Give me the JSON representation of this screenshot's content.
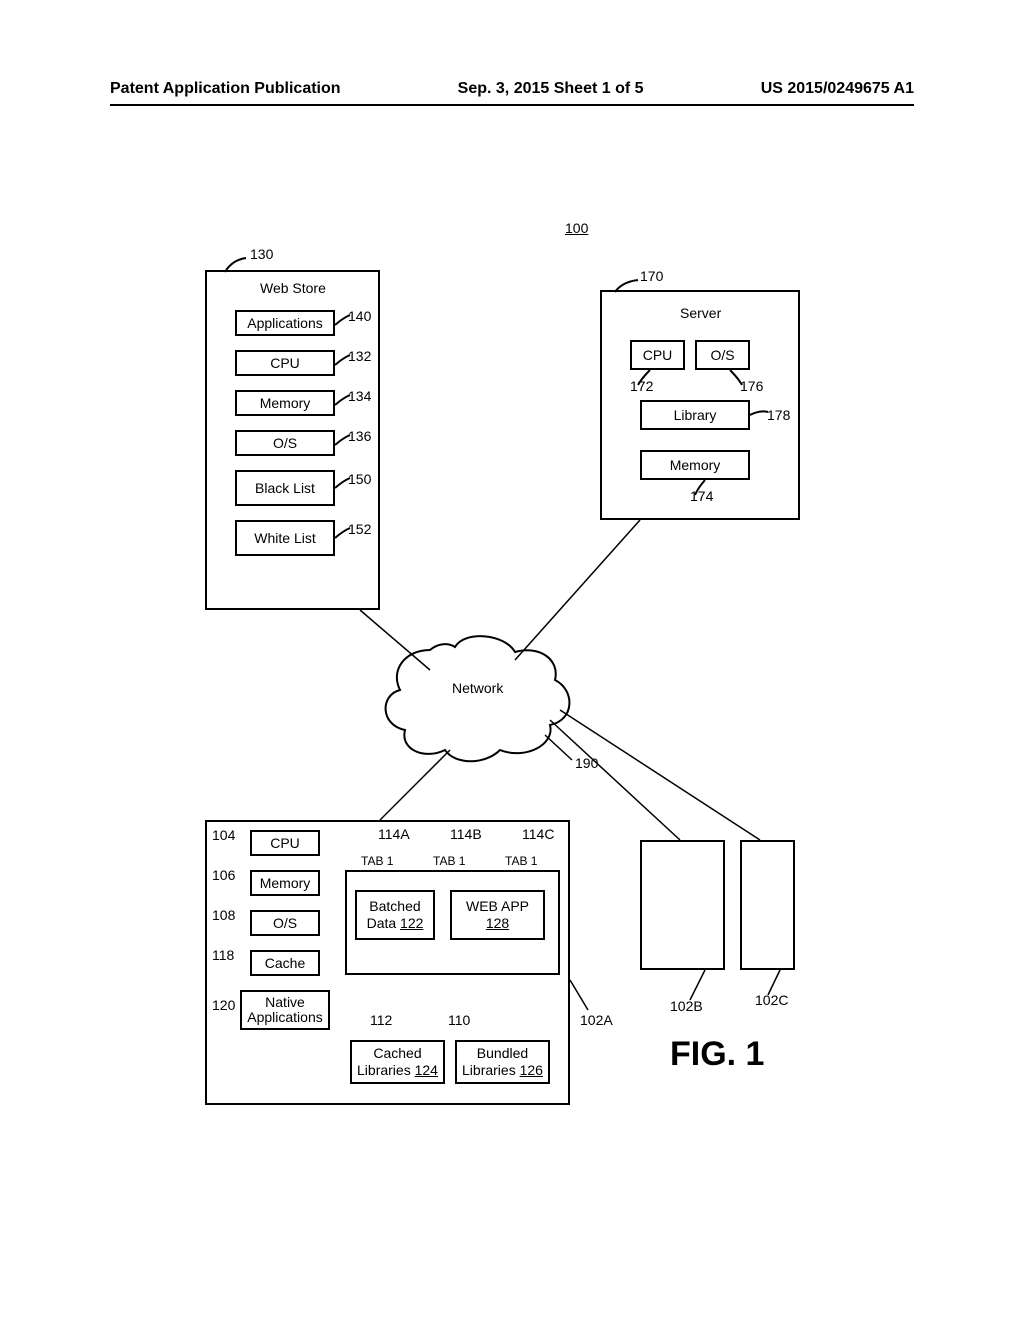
{
  "header": {
    "left": "Patent Application Publication",
    "center": "Sep. 3, 2015  Sheet 1 of 5",
    "right": "US 2015/0249675 A1"
  },
  "refs": {
    "sys": "100",
    "r130": "130",
    "r140": "140",
    "r132": "132",
    "r134": "134",
    "r136": "136",
    "r150": "150",
    "r152": "152",
    "r170": "170",
    "r172": "172",
    "r176": "176",
    "r178": "178",
    "r174": "174",
    "r190": "190",
    "r104": "104",
    "r106": "106",
    "r108": "108",
    "r118": "118",
    "r120": "120",
    "r114a": "114A",
    "r114b": "114B",
    "r114c": "114C",
    "r112": "112",
    "r110": "110",
    "r102a": "102A",
    "r102b": "102B",
    "r102c": "102C"
  },
  "labels": {
    "webstore_title": "Web Store",
    "applications": "Applications",
    "cpu": "CPU",
    "memory": "Memory",
    "os": "O/S",
    "blacklist": "Black List",
    "whitelist": "White List",
    "server_title": "Server",
    "library": "Library",
    "network": "Network",
    "native_apps": "Native\nApplications",
    "batched": "Batched\nData ",
    "batched_num": "122",
    "webapp": "WEB APP",
    "webapp_num": "128",
    "cached_lib": "Cached\nLibraries ",
    "cached_lib_num": "124",
    "bundled_lib": "Bundled\nLibraries ",
    "bundled_lib_num": "126",
    "cache": "Cache",
    "tab1": "TAB 1",
    "figure": "FIG. 1"
  }
}
